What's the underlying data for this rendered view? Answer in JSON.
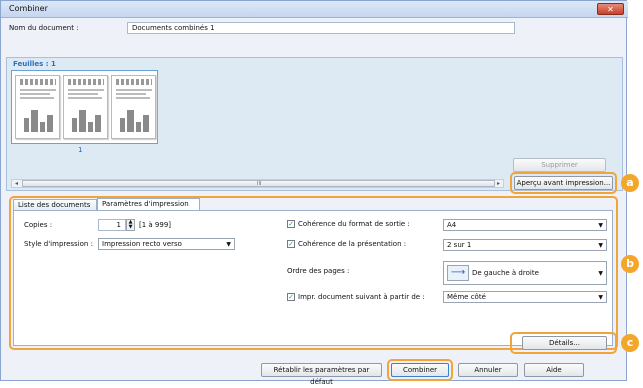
{
  "window": {
    "title": "Combiner",
    "close_glyph": "✕"
  },
  "doc_name": {
    "label": "Nom du document :",
    "value": "Documents combinés 1"
  },
  "pages": {
    "title": "Feuilles : 1",
    "page_number": "1",
    "thumb_count": 3
  },
  "side_buttons": {
    "delete": "Supprimer",
    "preview": "Aperçu avant impression..."
  },
  "scroll": {
    "left_glyph": "◂",
    "right_glyph": "▸",
    "grip": "III"
  },
  "tabs": [
    {
      "label": "Liste des documents"
    },
    {
      "label": "Paramètres d'impression"
    }
  ],
  "settings": {
    "copies_label": "Copies :",
    "copies_value": "1",
    "copies_range": "[1 à 999]",
    "print_style_label": "Style d'impression :",
    "print_style_value": "Impression recto verso",
    "output_format_label": "Cohérence du format de sortie :",
    "output_format_value": "A4",
    "layout_label": "Cohérence de la présentation :",
    "layout_value": "2 sur 1",
    "page_order_label": "Ordre des pages :",
    "page_order_value": "De gauche à droite",
    "next_doc_label": "Impr. document suivant à partir de :",
    "next_doc_value": "Même côté"
  },
  "details_button": "Détails...",
  "footer_buttons": {
    "reset": "Rétablir les paramètres par défaut",
    "combine": "Combiner",
    "cancel": "Annuler",
    "help": "Aide"
  },
  "callouts": {
    "a": "a",
    "b": "b",
    "c": "c"
  },
  "colors": {
    "callout": "#f4a62a",
    "page_number": "#2a64b7",
    "pages_title": "#2f6fbf"
  },
  "icons": {
    "close": "close-icon",
    "spin": "spin-arrows-icon",
    "caret": "chevron-down-icon",
    "check": "checkmark-icon",
    "page_order": "arrow-right-icon"
  }
}
